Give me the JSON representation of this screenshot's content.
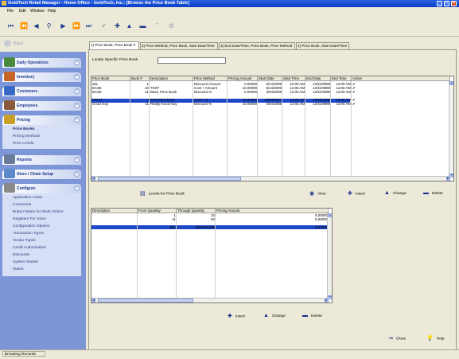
{
  "window": {
    "title": "GoldTech Retail Manager - Home Office  -  GoldTech, Inc.:  [Browse the Price Book Table]"
  },
  "menu": [
    "File",
    "Edit",
    "Window",
    "Help"
  ],
  "back_label": "Back",
  "sidebar": {
    "sections": [
      {
        "label": "Daily Operations",
        "icon": "register-icon",
        "color": "#4a8a3c"
      },
      {
        "label": "Inventory",
        "icon": "boxes-icon",
        "color": "#c86428"
      },
      {
        "label": "Customers",
        "icon": "customers-icon",
        "color": "#3a6ac8"
      },
      {
        "label": "Employees",
        "icon": "employees-icon",
        "color": "#8a5a3c"
      },
      {
        "label": "Pricing",
        "icon": "pricing-icon",
        "color": "#c8a028"
      },
      {
        "label": "Reports",
        "icon": "reports-icon",
        "color": "#6a7a9a"
      },
      {
        "label": "Store / Chain Setup",
        "icon": "store-icon",
        "color": "#5a8ac8"
      },
      {
        "label": "Configure",
        "icon": "configure-icon",
        "color": "#8a8a8a"
      }
    ],
    "pricing_links": [
      "Price Books",
      "Pricing Methods",
      "Price Levels"
    ],
    "configure_links": [
      "Application Areas",
      "Comments",
      "Button Matrix for Work Orders",
      "Registers For Store",
      "Configuration Options",
      "Transaction Types",
      "Tender Types",
      "Credit Authorization",
      "Discounts",
      "System Master",
      "States"
    ]
  },
  "tabs": [
    "1) Price Book, Price Book #",
    "2) Price Method, Price Book, Start Date/Time",
    "3) End Date/Time, Price Book, Price Method",
    "4) Price Book, Start Date/Time"
  ],
  "locate": {
    "label": "Locate Specific Price Book",
    "value": ""
  },
  "pricebook_table": {
    "headers": [
      "Price Book",
      "Book #",
      "Description",
      "Price Method",
      "Pricing Amount",
      "Start Date",
      "Start Time",
      "End Date",
      "End Time",
      "Active"
    ],
    "rows": [
      [
        "abc",
        "1",
        "",
        "Discount Amount",
        "0.00000",
        "5/14/2009",
        "12:00 AM",
        "12/31/9999",
        "12:00 AM",
        "✔"
      ],
      [
        "BASE",
        "20",
        "TEST",
        "Cost + Amount",
        "10.00000",
        "5/14/2009",
        "12:00 AM",
        "12/31/9999",
        "12:00 AM",
        "✔"
      ],
      [
        "BASE",
        "21",
        "Basic Price Book",
        "Discount %",
        "0.00000",
        "3/04/2009",
        "12:00 AM",
        "12/31/9999",
        "12:00 AM",
        "✔"
      ],
      [
        "Corporate Account",
        "2",
        "Corporate Pricing Deal",
        "Cost + %",
        "5.00000",
        "5/14/2009",
        "12:00 AM",
        "12/31/9999",
        "12:00 AM",
        "✔"
      ],
      [
        "FIRST",
        "4",
        "First Price book",
        "Cost + %",
        "10.00000",
        "12/03/2008",
        "12:00 AM",
        "12/26/2008",
        "12:00 AM",
        "✔"
      ],
      [
        "Good Guy",
        "11",
        "Really Good Guy",
        "Discount %",
        "10.00000",
        "3/04/2008",
        "12:00 AM",
        "12/31/9999",
        "12:00 AM",
        "✔"
      ]
    ],
    "selected_row": 3
  },
  "levels": {
    "label": "Levels for Price Book",
    "view_label": "View",
    "insert_label": "Insert",
    "change_label": "Change",
    "delete_label": "Delete"
  },
  "levels_table": {
    "headers": [
      "Description",
      "From Quantity",
      "Through Quantity",
      "Pricing Amount"
    ],
    "rows": [
      [
        "",
        "1",
        "10",
        "5.00000"
      ],
      [
        "",
        "11",
        "50",
        "6.00000"
      ],
      [
        "",
        "51",
        "500",
        "7.00000"
      ],
      [
        "",
        "501",
        "999,999,999",
        "8.00000"
      ]
    ],
    "selected_row": 2
  },
  "bottom_actions": {
    "insert": "Insert",
    "change": "Change",
    "delete": "Delete"
  },
  "footer": {
    "close": "Close",
    "help": "Help"
  },
  "status": "Browsing Records",
  "colors": {
    "selection": "#1e48c8",
    "sidebar_bg": "#7c96d8",
    "titlebar": "#0c3fc6"
  }
}
